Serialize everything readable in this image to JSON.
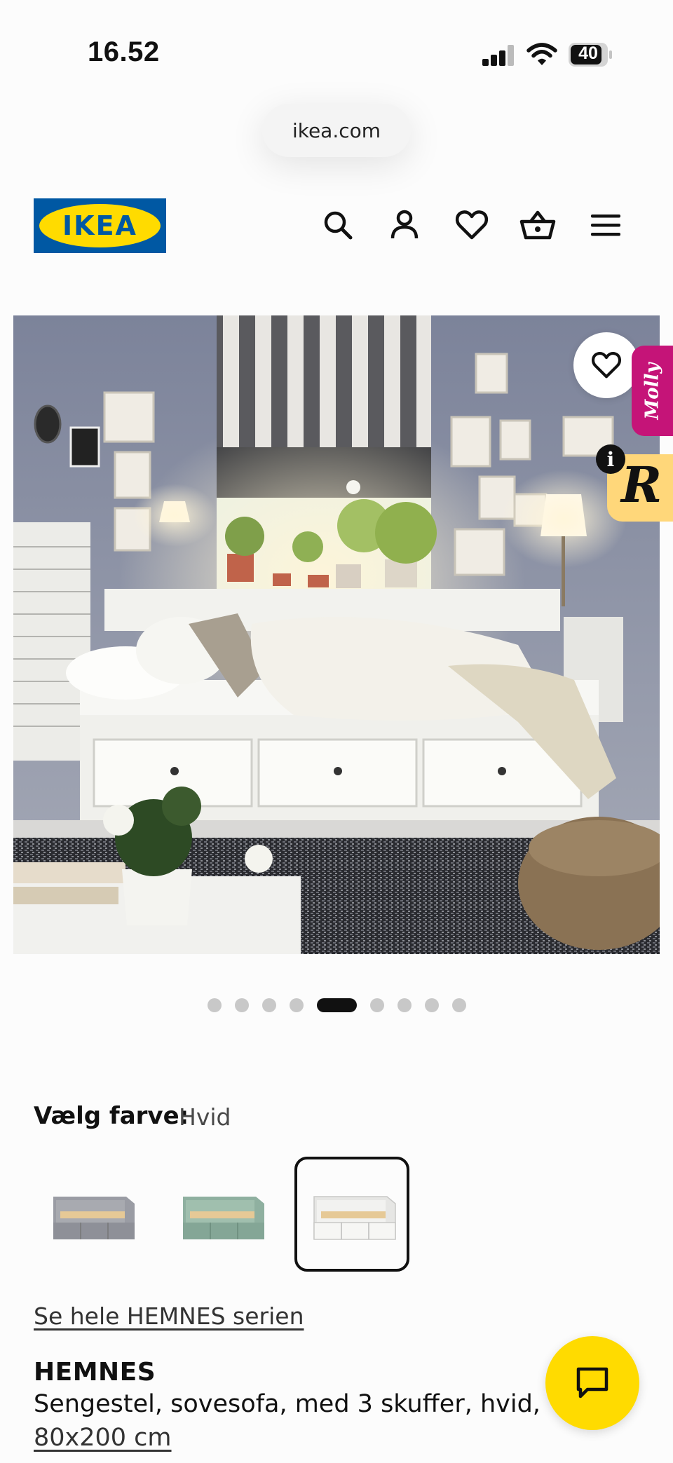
{
  "status_bar": {
    "time": "16.52",
    "battery": "40",
    "icons": [
      "signal-icon",
      "wifi-icon",
      "battery-icon"
    ]
  },
  "browser": {
    "url": "ikea.com"
  },
  "header": {
    "logo_text": "IKEA",
    "icons": [
      "search-icon",
      "account-icon",
      "heart-icon",
      "basket-icon",
      "menu-icon"
    ]
  },
  "hero": {
    "carousel": {
      "total": 9,
      "active": 5
    },
    "favourite_icon": "heart-icon",
    "molly_label": "Molly",
    "r_label": "R",
    "info_label": "i"
  },
  "colour_picker": {
    "label": "Vælg farve:",
    "selected": "Hvid",
    "swatches": [
      "Grå",
      "Grøn",
      "Hvid"
    ]
  },
  "series_link": "Se hele HEMNES serien",
  "product": {
    "name": "HEMNES",
    "description": "Sengestel, sovesofa, med 3 skuffer, hvid,",
    "size": "80x200 cm"
  },
  "chat_icon": "chat-icon",
  "colors": {
    "ikea_blue": "#0058a3",
    "ikea_yellow": "#ffdb00",
    "molly_pink": "#c51478",
    "r_yellow": "#ffd77a"
  }
}
